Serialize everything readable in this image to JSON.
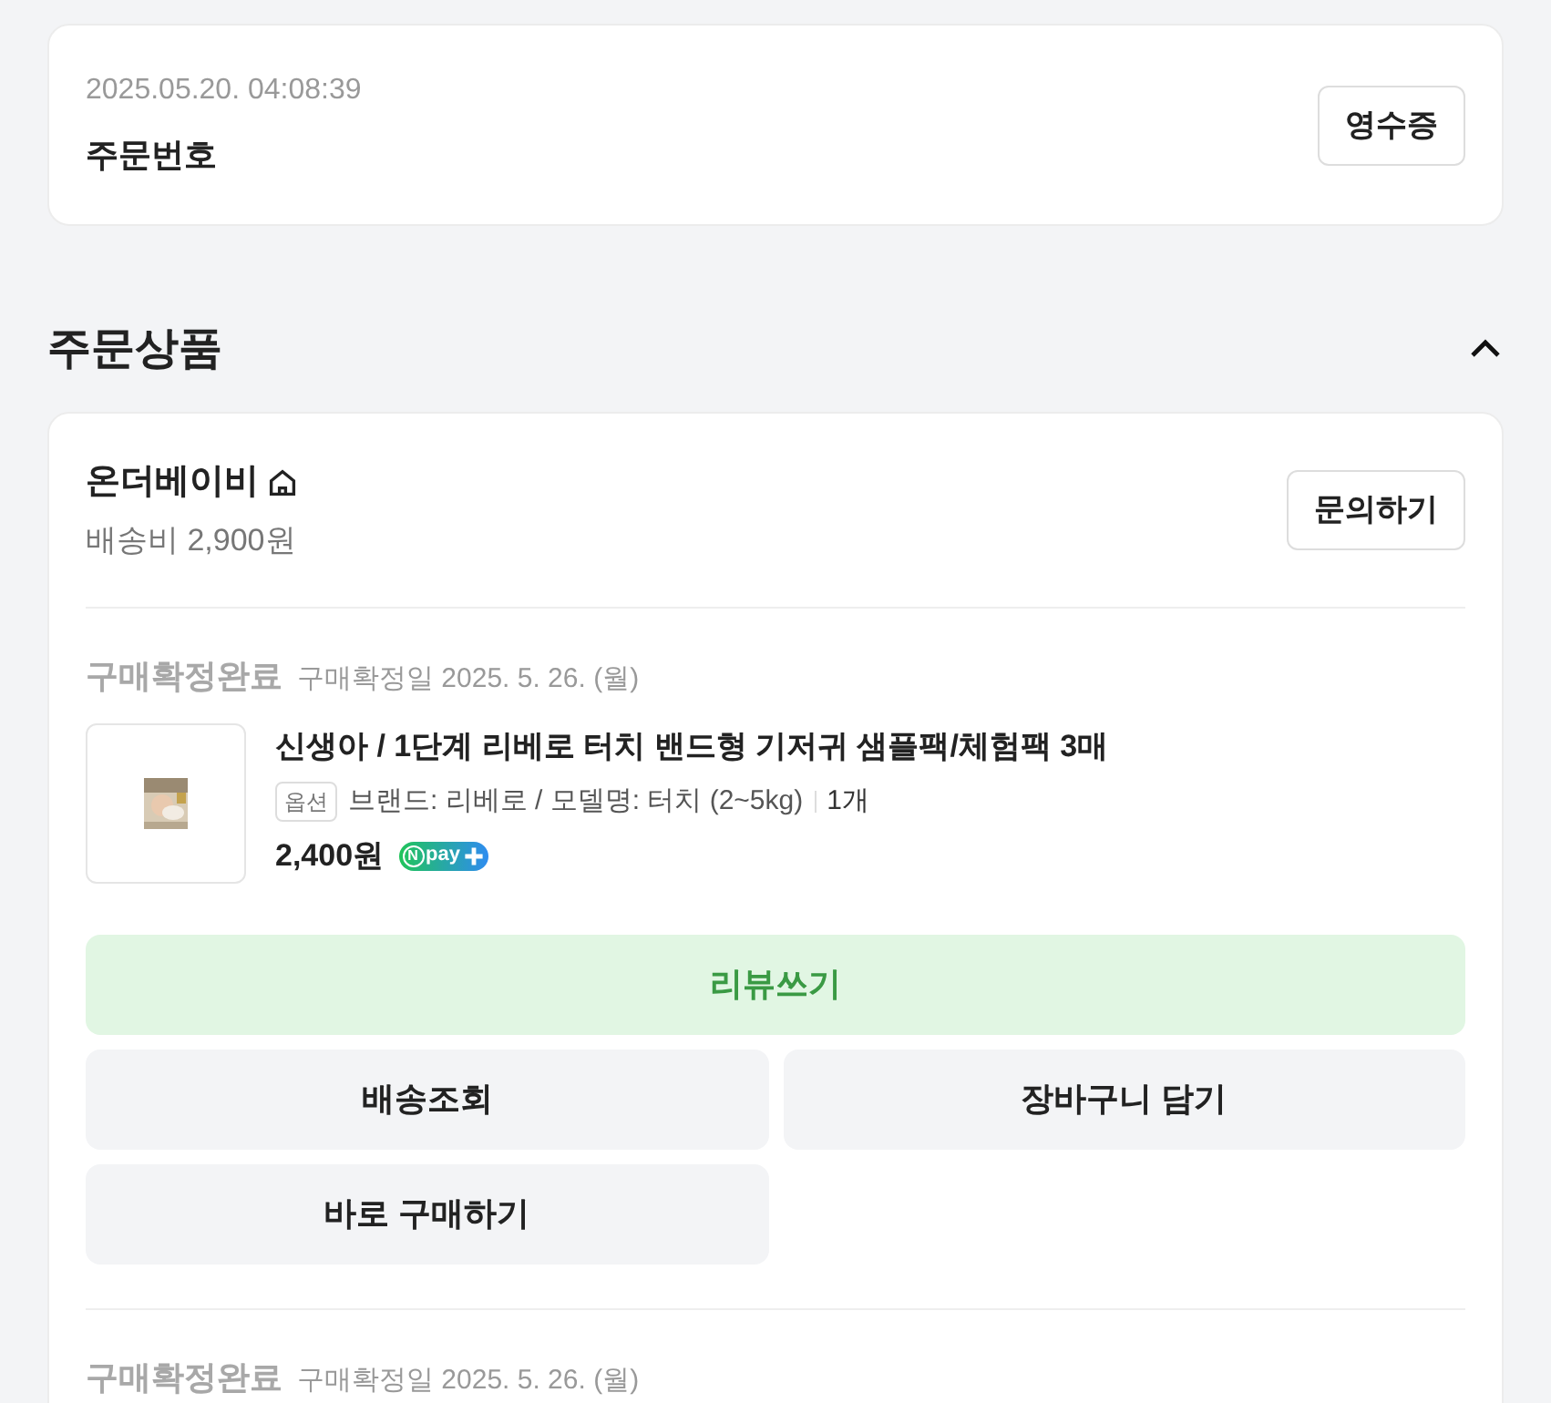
{
  "order": {
    "datetime": "2025.05.20. 04:08:39",
    "label": "주문번호",
    "receipt_button": "영수증"
  },
  "section": {
    "title": "주문상품",
    "expanded": true
  },
  "seller": {
    "name": "온더베이비",
    "shipping": "배송비 2,900원",
    "inquiry_button": "문의하기"
  },
  "items": [
    {
      "status": "구매확정완료",
      "confirm_date": "구매확정일 2025. 5. 26. (월)",
      "product": {
        "kind": "picture",
        "name": "신생아 / 1단계 리베로 터치 밴드형 기저귀 샘플팩/체험팩 3매",
        "option_tag": "옵션",
        "option": "브랜드: 리베로 / 모델명: 터치 (2~5kg)",
        "quantity": "1개",
        "price": "2,400원",
        "pay_badge": {
          "mark": "N",
          "text": "pay"
        }
      },
      "actions": [
        {
          "label": "리뷰쓰기",
          "kind": "primary"
        },
        {
          "label": "배송조회",
          "kind": "secondary"
        },
        {
          "label": "장바구니 담기",
          "kind": "secondary"
        },
        {
          "label": "바로 구매하기",
          "kind": "secondary"
        }
      ]
    },
    {
      "status": "구매확정완료",
      "confirm_date": "구매확정일 2025. 5. 26. (월)"
    }
  ]
}
